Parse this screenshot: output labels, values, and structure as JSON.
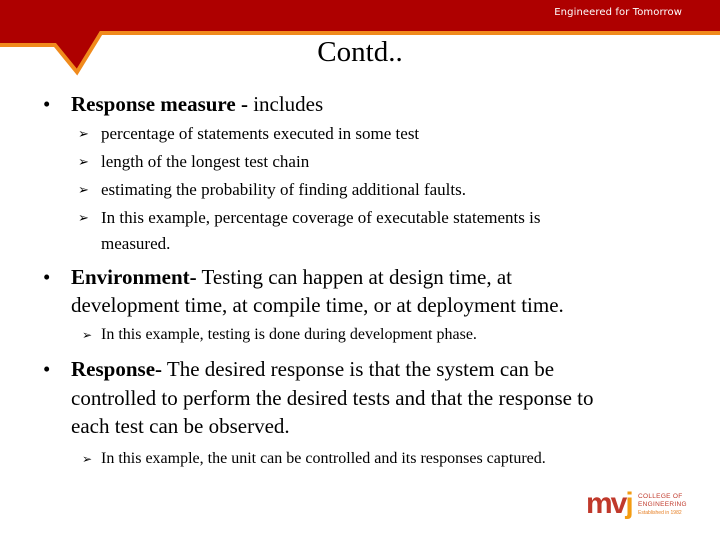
{
  "header": {
    "tagline": "Engineered for Tomorrow",
    "colors": {
      "band": "#AE0000",
      "stripe": "#F08A1C"
    }
  },
  "slide": {
    "title": "Contd..",
    "sections": [
      {
        "bullet": "•",
        "heading": "Response measure - ",
        "text": " includes",
        "items": [
          "percentage of statements executed in some test",
          "length of the longest test chain",
          "estimating the probability of finding additional faults.",
          "In this example, percentage coverage of executable statements is",
          "measured."
        ]
      },
      {
        "bullet": "•",
        "heading": "Environment-",
        "text_line1": " Testing can happen at design time, at",
        "text_line2": "development time, at compile time, or at deployment time.",
        "items": [
          "In this example, testing  is done during development phase."
        ]
      },
      {
        "bullet": "•",
        "heading": "Response-",
        "text_line1": " The desired response is that the system can be",
        "text_line2": "controlled to perform the desired tests and that the response to",
        "text_line3": "each test can be observed.",
        "items": [
          "In this example, the unit can be controlled and its responses captured."
        ]
      }
    ],
    "sub_bullet_glyph": "➢"
  },
  "logo": {
    "mark_mv": "mv",
    "mark_j": "j",
    "name_line1": "COLLEGE OF",
    "name_line2": "ENGINEERING",
    "tagline": "Established in 1982"
  }
}
